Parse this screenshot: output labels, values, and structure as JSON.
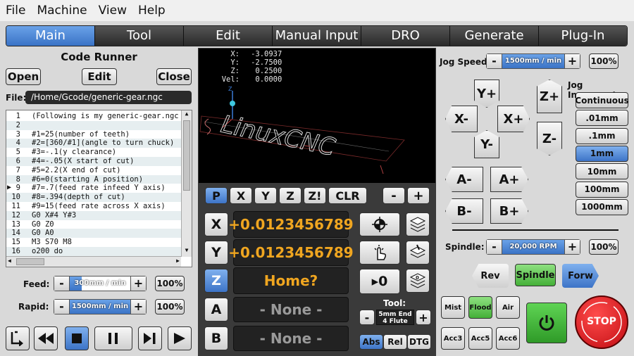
{
  "menu": [
    "File",
    "Machine",
    "View",
    "Help"
  ],
  "tabs": [
    "Main",
    "Tool",
    "Edit",
    "Manual Input",
    "DRO",
    "Generate",
    "Plug-In"
  ],
  "active_tab": 0,
  "code_runner": {
    "title": "Code Runner",
    "open_label": "Open",
    "edit_label": "Edit",
    "close_label": "Close",
    "file_label": "File:",
    "file_path": "/Home/Gcode/generic-gear.ngc",
    "current_line": 9,
    "lines": [
      {
        "n": "1",
        "text": "(Following is my generic-gear.ngc"
      },
      {
        "n": "2",
        "text": ""
      },
      {
        "n": "3",
        "text": "#1=25(number of teeth)"
      },
      {
        "n": "4",
        "text": "#2=[360/#1](angle to turn chuck)"
      },
      {
        "n": "5",
        "text": "#3=-.1(y clearance)"
      },
      {
        "n": "6",
        "text": "#4=-.05(X start of cut)"
      },
      {
        "n": "7",
        "text": "#5=2.2(X end of cut)"
      },
      {
        "n": "8",
        "text": "#6=0(starting A position)"
      },
      {
        "n": "9",
        "text": "#7=.7(feed rate infeed Y axis)"
      },
      {
        "n": "10",
        "text": "#8=.394(depth of cut)"
      },
      {
        "n": "11",
        "text": "#9=15(feed rate across X axis)"
      },
      {
        "n": "12",
        "text": "G0 X#4 Y#3"
      },
      {
        "n": "13",
        "text": "G0 Z0"
      },
      {
        "n": "14",
        "text": "G0 A0"
      },
      {
        "n": "15",
        "text": "M3 S70 M8"
      },
      {
        "n": "16",
        "text": "o200 do"
      }
    ]
  },
  "feed": {
    "label": "Feed:",
    "value": "300mm / min",
    "fill": 0.2,
    "pct": "100%"
  },
  "rapid": {
    "label": "Rapid:",
    "value": "1500mm / min",
    "fill": 1.0,
    "pct": "100%"
  },
  "preview": {
    "x_label": "X:",
    "x_val": "-3.0937",
    "y_label": "Y:",
    "y_val": "-2.7500",
    "z_label": "Z:",
    "z_val": "0.2500",
    "vel_label": "Vel:",
    "vel_val": "0.0000",
    "logo_text": "LinuxCNC"
  },
  "view_buttons": [
    "P",
    "X",
    "Y",
    "Z",
    "Z!",
    "CLR"
  ],
  "zoom": {
    "minus": "-",
    "plus": "+"
  },
  "dro": {
    "axes": [
      {
        "axis": "X",
        "value": "+0.0123456789"
      },
      {
        "axis": "Y",
        "value": "+0.0123456789"
      },
      {
        "axis": "Z",
        "value": "Home?"
      },
      {
        "axis": "A",
        "value": "- None -"
      },
      {
        "axis": "B",
        "value": "- None -"
      }
    ]
  },
  "tool": {
    "label": "Tool:",
    "name_line1": "5mm End",
    "name_line2": "4 Flute"
  },
  "coord_modes": [
    "Abs",
    "Rel",
    "DTG"
  ],
  "zero_label": "▸0",
  "jog": {
    "speed_label": "Jog Speed:",
    "speed_value": "1500mm / min",
    "speed_fill": 1.0,
    "speed_pct": "100%",
    "increment_label": "Jog Increment:",
    "increments": [
      "Continuous",
      ".01mm",
      ".1mm",
      "1mm",
      "10mm",
      "100mm",
      "1000mm"
    ],
    "selected_increment": 3,
    "buttons": {
      "yplus": "Y+",
      "yminus": "Y-",
      "xminus": "X-",
      "xplus": "X+",
      "zplus": "Z+",
      "zminus": "Z-",
      "aminus": "A-",
      "aplus": "A+",
      "bminus": "B-",
      "bplus": "B+"
    }
  },
  "spindle": {
    "label": "Spindle:",
    "value": "20,000 RPM",
    "fill": 1.0,
    "pct": "100%",
    "rev_label": "Rev",
    "spindle_label": "Spindle",
    "forw_label": "Forw"
  },
  "coolant": {
    "mist": "Mist",
    "flood": "Flood",
    "air": "Air"
  },
  "accessories": [
    "Acc3",
    "Acc5",
    "Acc6"
  ],
  "stop_label": "STOP",
  "colors": {
    "accent": "#3a73c6",
    "dro_text": "#f0a620",
    "stop": "#d8141b",
    "power": "#3db034"
  }
}
